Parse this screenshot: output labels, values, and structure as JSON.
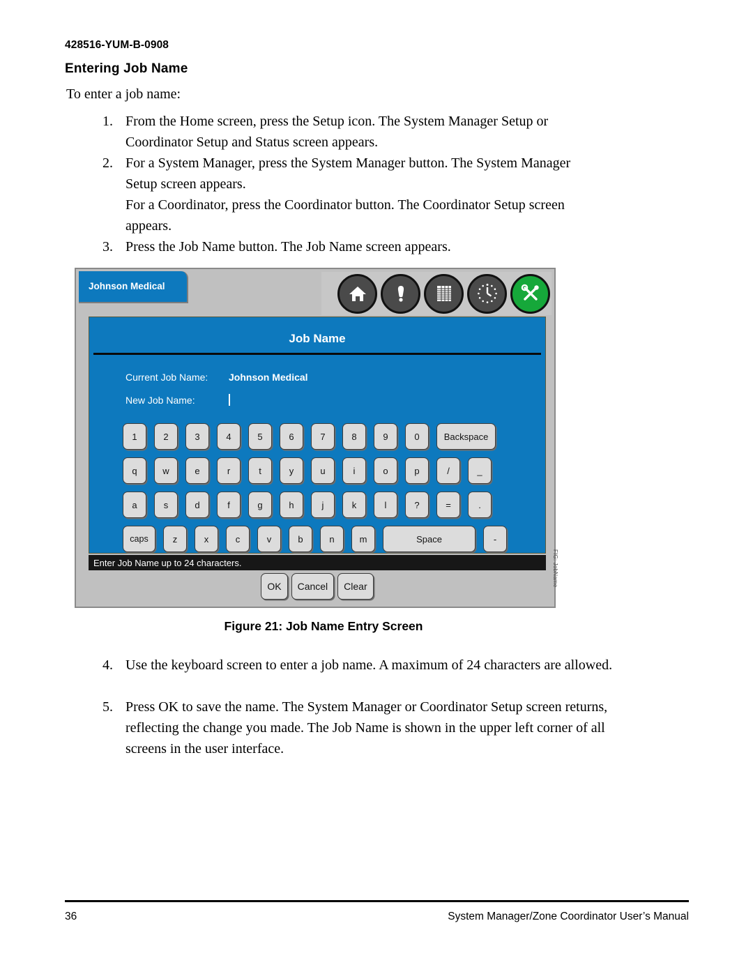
{
  "document": {
    "doc_code": "428516-YUM-B-0908",
    "heading": "Entering Job Name",
    "lead": "To enter a job name:",
    "steps": [
      {
        "num": "1.",
        "text": "From the Home screen, press the Setup icon. The System Manager Setup or Coordinator Setup and Status screen appears."
      },
      {
        "num": "2.",
        "text": "For a System Manager, press the System Manager button. The System Manager Setup screen appears."
      },
      {
        "num": "",
        "text": "For a Coordinator, press the Coordinator button. The Coordinator Setup screen appears."
      },
      {
        "num": "3.",
        "text": "Press the Job Name button. The Job Name screen appears."
      },
      {
        "num": "4.",
        "text": "Use the keyboard screen to enter a job name. A maximum of 24 characters are allowed."
      },
      {
        "num": "5.",
        "text": "Press OK to save the name. The System Manager or Coordinator Setup screen returns, reflecting the change you made. The Job Name is shown in the upper left corner of all screens in the user interface."
      }
    ],
    "figure_caption": "Figure 21: Job Name Entry Screen",
    "figure_side_label": "FIG: JobName"
  },
  "footer": {
    "page_number": "36",
    "manual_title": "System Manager/Zone Coordinator User’s Manual"
  },
  "screen": {
    "job_tab_label": "Johnson Medical",
    "panel_title": "Job Name",
    "fields": [
      {
        "label": "Current Job Name:",
        "value": "Johnson Medical"
      },
      {
        "label": "New Job Name:",
        "value": ""
      }
    ],
    "status_message": "Enter Job Name up to 24 characters.",
    "toolbar_icons": [
      {
        "name": "home-icon",
        "style": "dark"
      },
      {
        "name": "alert-icon",
        "style": "dark"
      },
      {
        "name": "table-icon",
        "style": "dark"
      },
      {
        "name": "clock-icon",
        "style": "dark"
      },
      {
        "name": "tools-icon",
        "style": "green"
      }
    ],
    "keyboard": {
      "rows": [
        [
          "1",
          "2",
          "3",
          "4",
          "5",
          "6",
          "7",
          "8",
          "9",
          "0",
          "Backspace"
        ],
        [
          "q",
          "w",
          "e",
          "r",
          "t",
          "y",
          "u",
          "i",
          "o",
          "p",
          "/",
          "_"
        ],
        [
          "a",
          "s",
          "d",
          "f",
          "g",
          "h",
          "j",
          "k",
          "l",
          "?",
          "=",
          "."
        ],
        [
          "caps",
          "z",
          "x",
          "c",
          "v",
          "b",
          "n",
          "m",
          "Space",
          "-"
        ]
      ]
    },
    "dialog_buttons": [
      "OK",
      "Cancel",
      "Clear"
    ],
    "colors": {
      "panel_blue": "#0d79be",
      "frame_gray": "#c0c0c0",
      "key_gray": "#dcdcdc",
      "status_black": "#171717",
      "icon_dark": "#4a4a4a",
      "icon_green": "#16a83a"
    }
  }
}
